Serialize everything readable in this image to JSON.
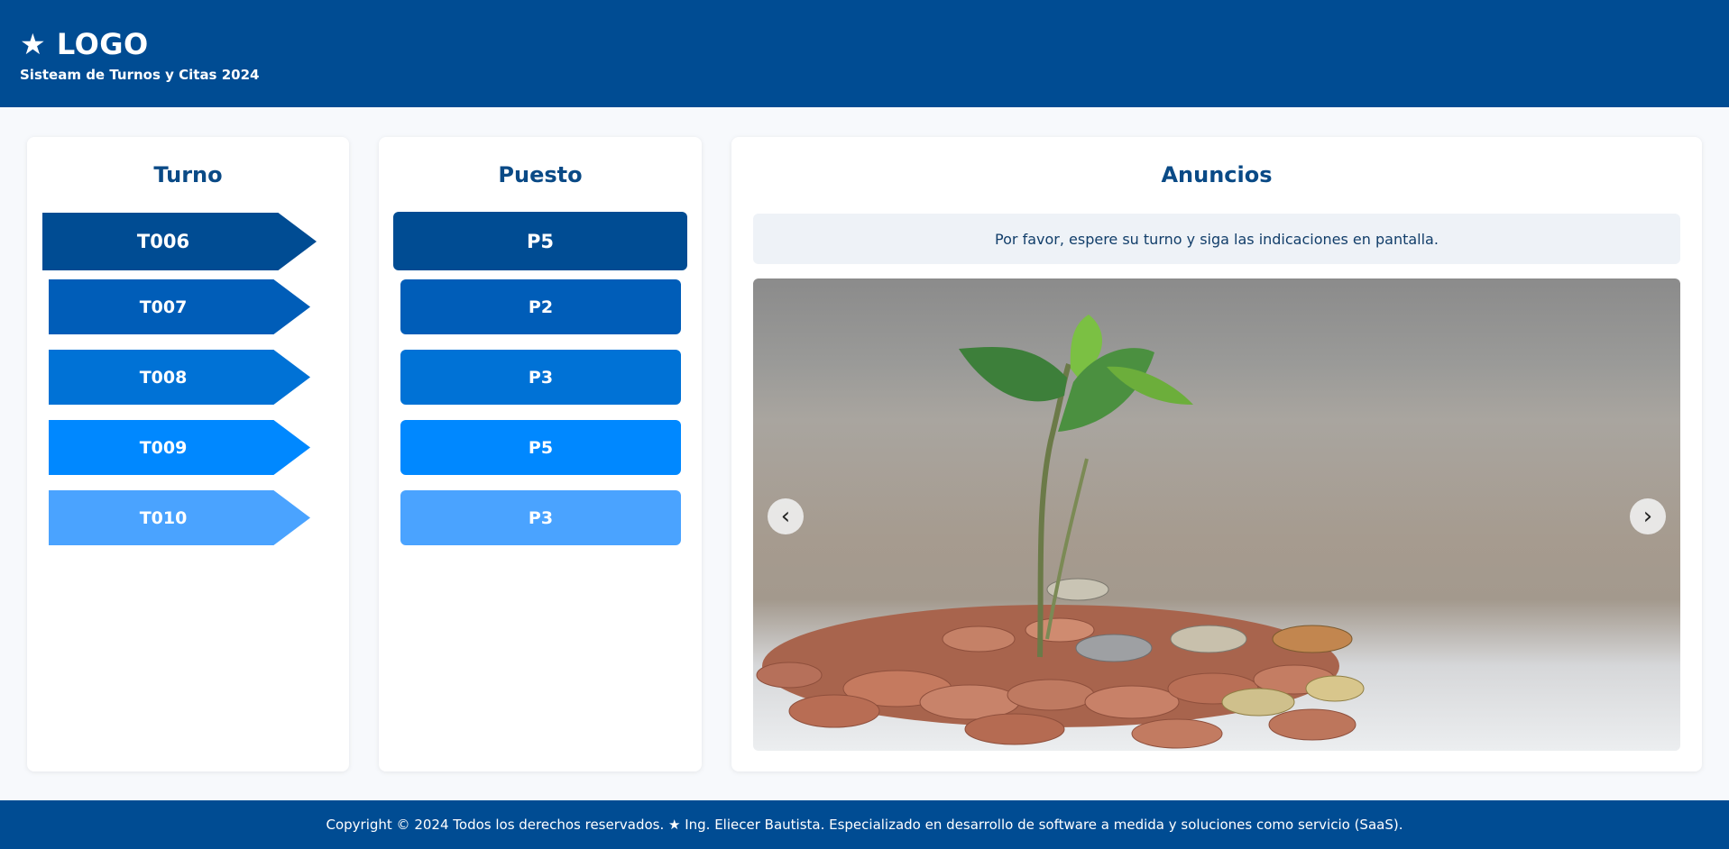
{
  "header": {
    "logo": "★ LOGO",
    "subtitle": "Sisteam de Turnos y Citas 2024"
  },
  "turno": {
    "title": "Turno",
    "items": [
      "T006",
      "T007",
      "T008",
      "T009",
      "T010"
    ]
  },
  "puesto": {
    "title": "Puesto",
    "items": [
      "P5",
      "P2",
      "P3",
      "P5",
      "P3"
    ]
  },
  "anuncios": {
    "title": "Anuncios",
    "message": "Por favor, espere su turno y siga las indicaciones en pantalla.",
    "prev_icon": "‹",
    "next_icon": "›"
  },
  "footer": {
    "text": "Copyright © 2024 Todos los derechos reservados. ★ Ing. Eliecer Bautista. Especializado en desarrollo de software a medida y soluciones como servicio (SaaS)."
  },
  "colors": {
    "brand": "#004c93",
    "row_colors": [
      "#004c93",
      "#005db8",
      "#0072d6",
      "#0088ff",
      "#4aa3ff"
    ]
  }
}
